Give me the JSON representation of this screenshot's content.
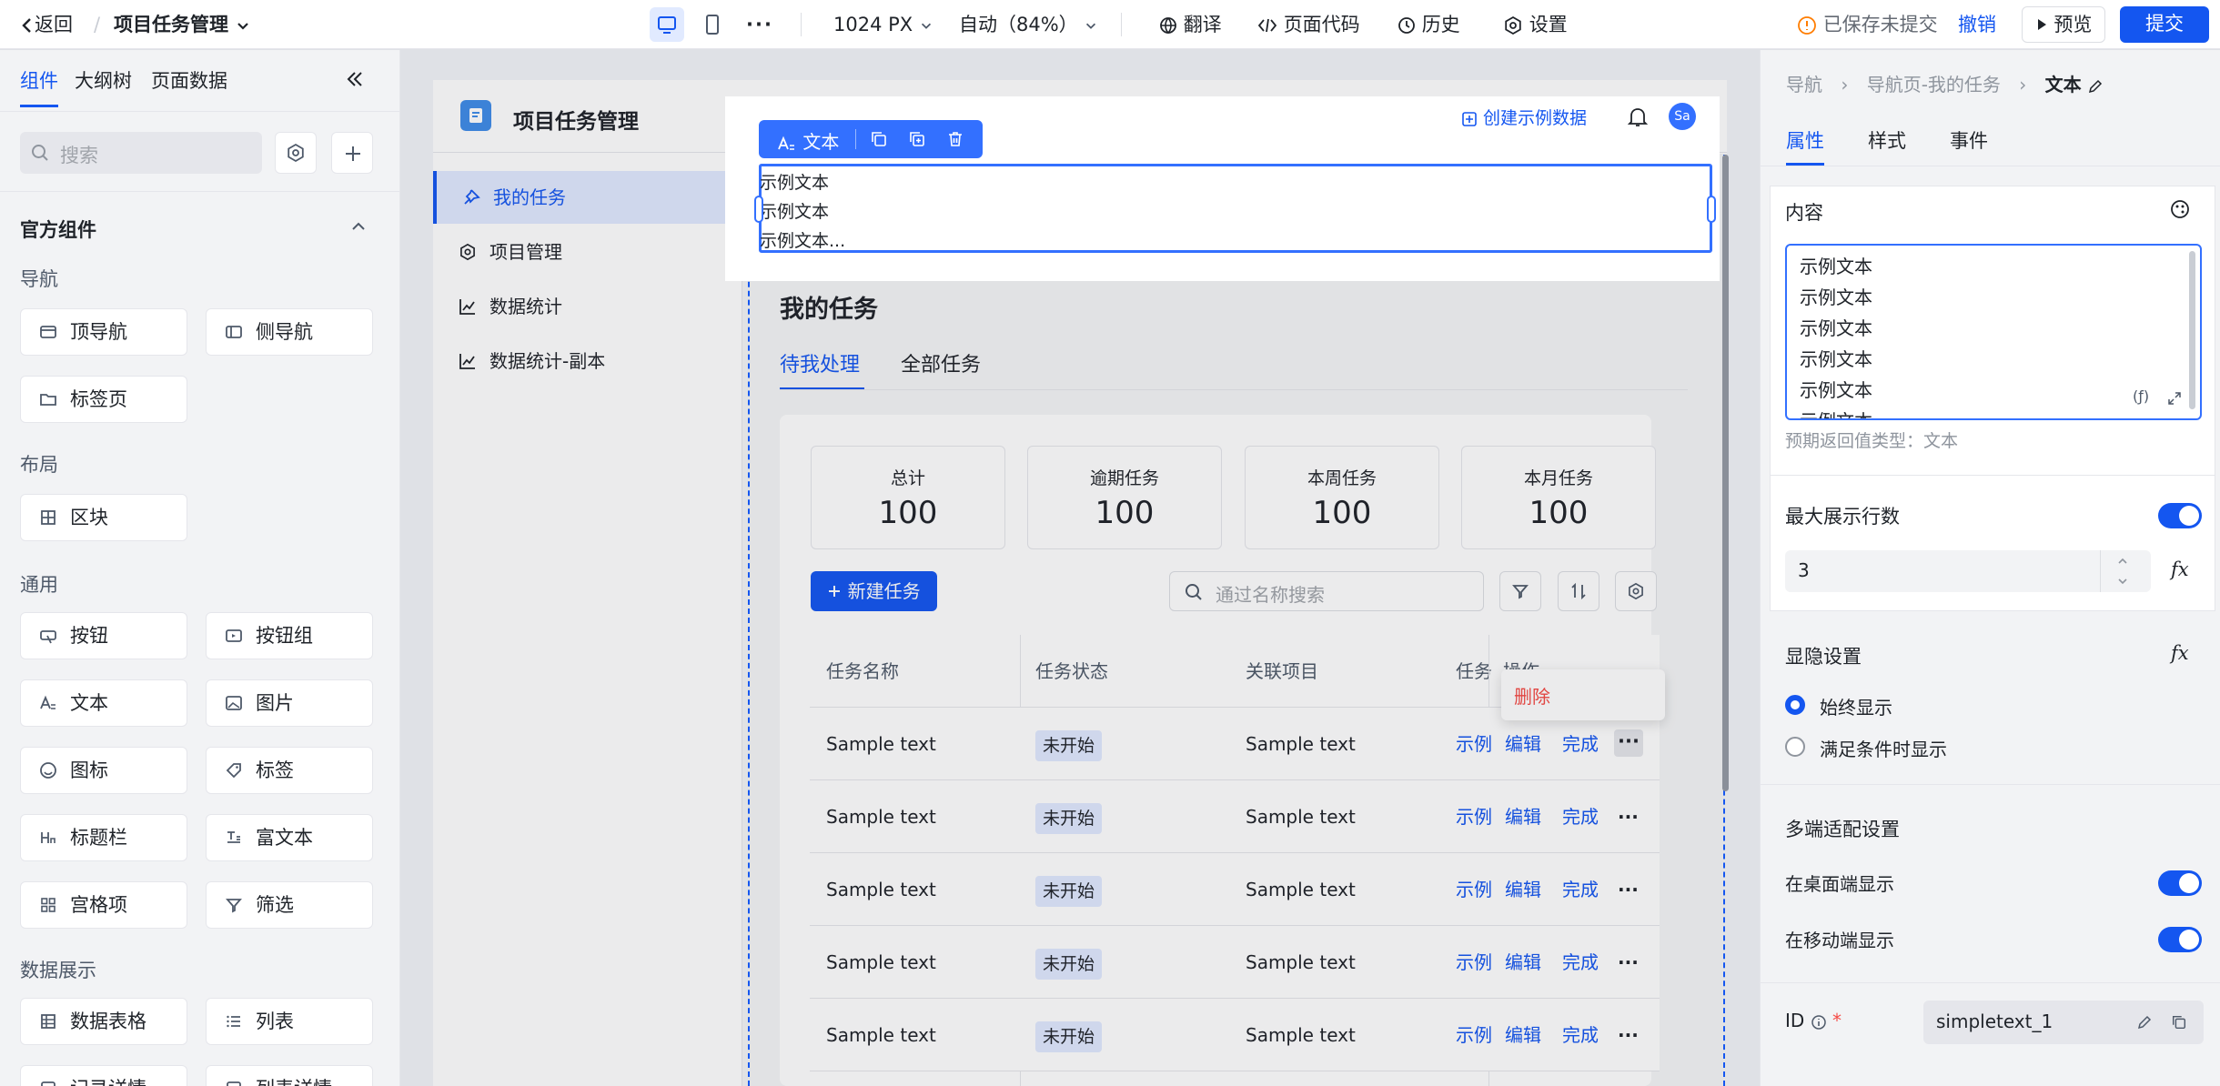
{
  "topbar": {
    "back": "返回",
    "app_title": "项目任务管理",
    "resolution": "1024 PX",
    "zoom": "自动（84%）",
    "translate": "翻译",
    "page_code": "页面代码",
    "history": "历史",
    "settings": "设置",
    "save_status": "已保存未提交",
    "undo": "撤销",
    "preview": "预览",
    "submit": "提交"
  },
  "left_panel": {
    "tabs": [
      "组件",
      "大纲树",
      "页面数据"
    ],
    "search_placeholder": "搜索",
    "section_title": "官方组件",
    "groups": {
      "nav": "导航",
      "layout": "布局",
      "general": "通用",
      "data": "数据展示"
    },
    "components": {
      "top_nav": "顶导航",
      "side_nav": "侧导航",
      "tab_page": "标签页",
      "block": "区块",
      "button": "按钮",
      "button_group": "按钮组",
      "text": "文本",
      "image": "图片",
      "icon": "图标",
      "tag": "标签",
      "title_bar": "标题栏",
      "rich_text": "富文本",
      "grid_item": "宫格项",
      "filter": "筛选",
      "data_table": "数据表格",
      "list": "列表",
      "record_detail": "记录详情",
      "list_detail": "列表详情"
    }
  },
  "canvas": {
    "app_name": "项目任务管理",
    "create_sample": "创建示例数据",
    "avatar": "Sa",
    "nav_items": [
      "我的任务",
      "项目管理",
      "数据统计",
      "数据统计-副本"
    ],
    "toolbar_label": "文本",
    "selected_text_lines": [
      "示例文本",
      "示例文本",
      "示例文本..."
    ],
    "page_title": "我的任务",
    "tabs": [
      "待我处理",
      "全部任务"
    ],
    "stats": [
      {
        "label": "总计",
        "value": "100"
      },
      {
        "label": "逾期任务",
        "value": "100"
      },
      {
        "label": "本周任务",
        "value": "100"
      },
      {
        "label": "本月任务",
        "value": "100"
      }
    ],
    "new_task": "新建任务",
    "search_placeholder": "通过名称搜索",
    "table_headers": [
      "任务名称",
      "任务状态",
      "关联项目",
      "任务",
      "操作"
    ],
    "dropdown_delete": "删除",
    "rows": [
      {
        "name": "Sample text",
        "status": "未开始",
        "project": "Sample text",
        "task": "示例",
        "edit": "编辑",
        "done": "完成"
      },
      {
        "name": "Sample text",
        "status": "未开始",
        "project": "Sample text",
        "task": "示例",
        "edit": "编辑",
        "done": "完成"
      },
      {
        "name": "Sample text",
        "status": "未开始",
        "project": "Sample text",
        "task": "示例",
        "edit": "编辑",
        "done": "完成"
      },
      {
        "name": "Sample text",
        "status": "未开始",
        "project": "Sample text",
        "task": "示例",
        "edit": "编辑",
        "done": "完成"
      },
      {
        "name": "Sample text",
        "status": "未开始",
        "project": "Sample text",
        "task": "示例",
        "edit": "编辑",
        "done": "完成"
      }
    ]
  },
  "right_panel": {
    "breadcrumb": [
      "导航",
      "导航页-我的任务",
      "文本"
    ],
    "tabs": [
      "属性",
      "样式",
      "事件"
    ],
    "content_label": "内容",
    "content_lines": [
      "示例文本",
      "示例文本",
      "示例文本",
      "示例文本",
      "示例文本",
      "示例文本"
    ],
    "return_type": "预期返回值类型：文本",
    "max_lines_label": "最大展示行数",
    "max_lines_value": "3",
    "visibility_label": "显隐设置",
    "always_show": "始终显示",
    "conditional_show": "满足条件时显示",
    "multi_device": "多端适配设置",
    "desktop_show": "在桌面端显示",
    "mobile_show": "在移动端显示",
    "id_label": "ID",
    "id_value": "simpletext_1",
    "fx": "fx"
  },
  "colors": {
    "accent": "#1456f0",
    "danger": "#f54a45",
    "tag_bg": "#e1eaff"
  }
}
